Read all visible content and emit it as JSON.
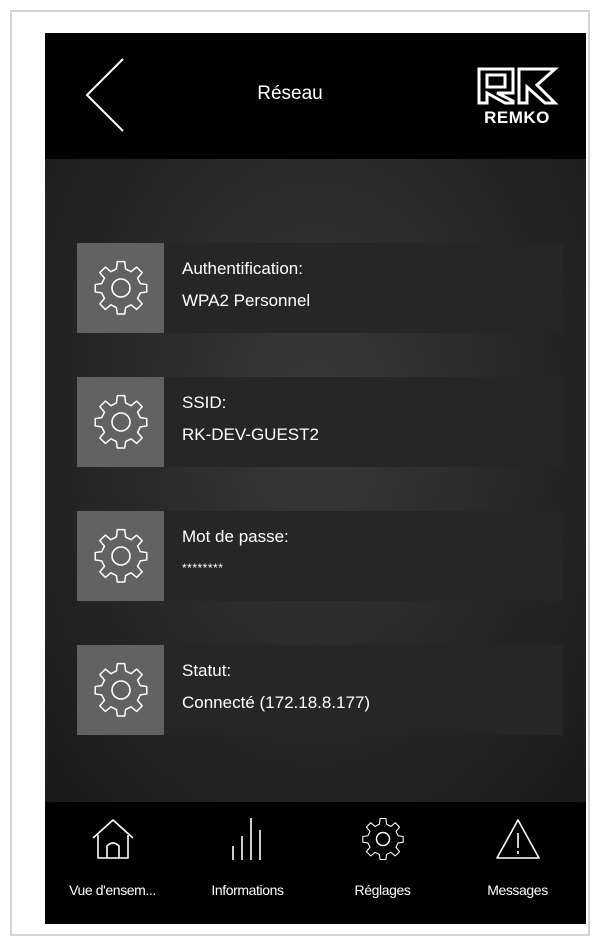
{
  "header": {
    "title": "Réseau",
    "brand": "REMKO",
    "back_icon": "chevron-left-icon"
  },
  "settings": [
    {
      "label": "Authentification:",
      "value": "WPA2 Personnel",
      "icon": "gear-icon"
    },
    {
      "label": "SSID:",
      "value": "RK-DEV-GUEST2",
      "icon": "gear-icon"
    },
    {
      "label": "Mot de passe:",
      "value": "********",
      "icon": "gear-icon"
    },
    {
      "label": "Statut:",
      "value": "Connecté (172.18.8.177)",
      "icon": "gear-icon"
    }
  ],
  "nav": [
    {
      "label": "Vue d'ensem...",
      "icon": "home-icon"
    },
    {
      "label": "Informations",
      "icon": "bar-chart-icon"
    },
    {
      "label": "Réglages",
      "icon": "gear-icon"
    },
    {
      "label": "Messages",
      "icon": "warning-icon"
    }
  ],
  "colors": {
    "header_bg": "#000000",
    "content_bg": "#2a2a2a",
    "icon_box_bg": "#626262",
    "text_box_bg": "#262626",
    "text": "#ffffff"
  }
}
